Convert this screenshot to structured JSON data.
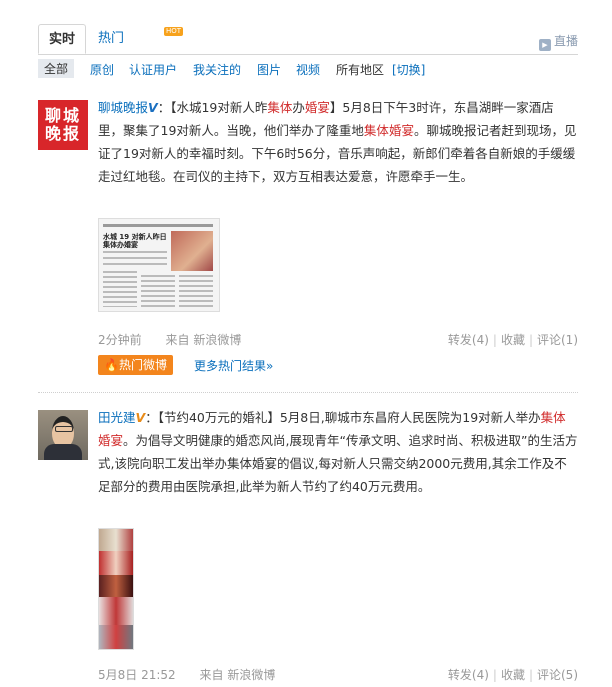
{
  "tabs": {
    "active": "实时",
    "hot": "热门",
    "hot_badge": "HOT",
    "live_icon": "play-icon",
    "live_label": "直播"
  },
  "filters": {
    "all": "全部",
    "items": [
      "原创",
      "认证用户",
      "我关注的",
      "图片",
      "视频"
    ],
    "region": "所有地区",
    "switch": "[切换]"
  },
  "post1": {
    "username": "聊城晚报",
    "logo_text": "聊城晚报",
    "verified_badge": "V",
    "text_parts": [
      "：【水城19对新人昨",
      "集体",
      "办",
      "婚宴",
      "】5月8日下午3时许，东昌湖畔一家酒店里，聚集了19对新人。当晚，他们举办了隆重地",
      "集体",
      "婚宴",
      "。聊城晚报记者赶到现场，见证了19对新人的幸福时刻。下午6时56分，音乐声响起，新郎们牵着各自新娘的手缓缓走过红地毯。在司仪的主持下，双方互相表达爱意，许愿牵手一生。"
    ],
    "image_headline": "水城 19 对新人昨日集体办婚宴",
    "time": "2分钟前",
    "source_prefix": "来自",
    "source": "新浪微博",
    "forward": "转发(4)",
    "favorite": "收藏",
    "comment": "评论(1)",
    "hot_button": "热门微博",
    "more_hot": "更多热门结果»"
  },
  "post2": {
    "username": "田光建",
    "verified_badge": "V",
    "text_parts": [
      "：【节约40万元的婚礼】5月8日,聊城市东昌府人民医院为19对新人举办",
      "集体",
      "婚宴",
      "。为倡导文明健康的婚恋风尚,展现青年“传承文明、追求时尚、积极进取”的生活方式,该院向职工发出举办集体婚宴的倡议,每对新人只需交纳2000元费用,其余工作及不足部分的费用由医院承担,此举为新人节约了约40万元费用。"
    ],
    "time": "5月8日 21:52",
    "source_prefix": "来自",
    "source": "新浪微博",
    "forward": "转发(4)",
    "favorite": "收藏",
    "comment": "评论(5)"
  },
  "colors": {
    "link": "#0a6fbc",
    "highlight": "#d12c2c",
    "hot_orange": "#f3851d",
    "meta_gray": "#999999"
  }
}
